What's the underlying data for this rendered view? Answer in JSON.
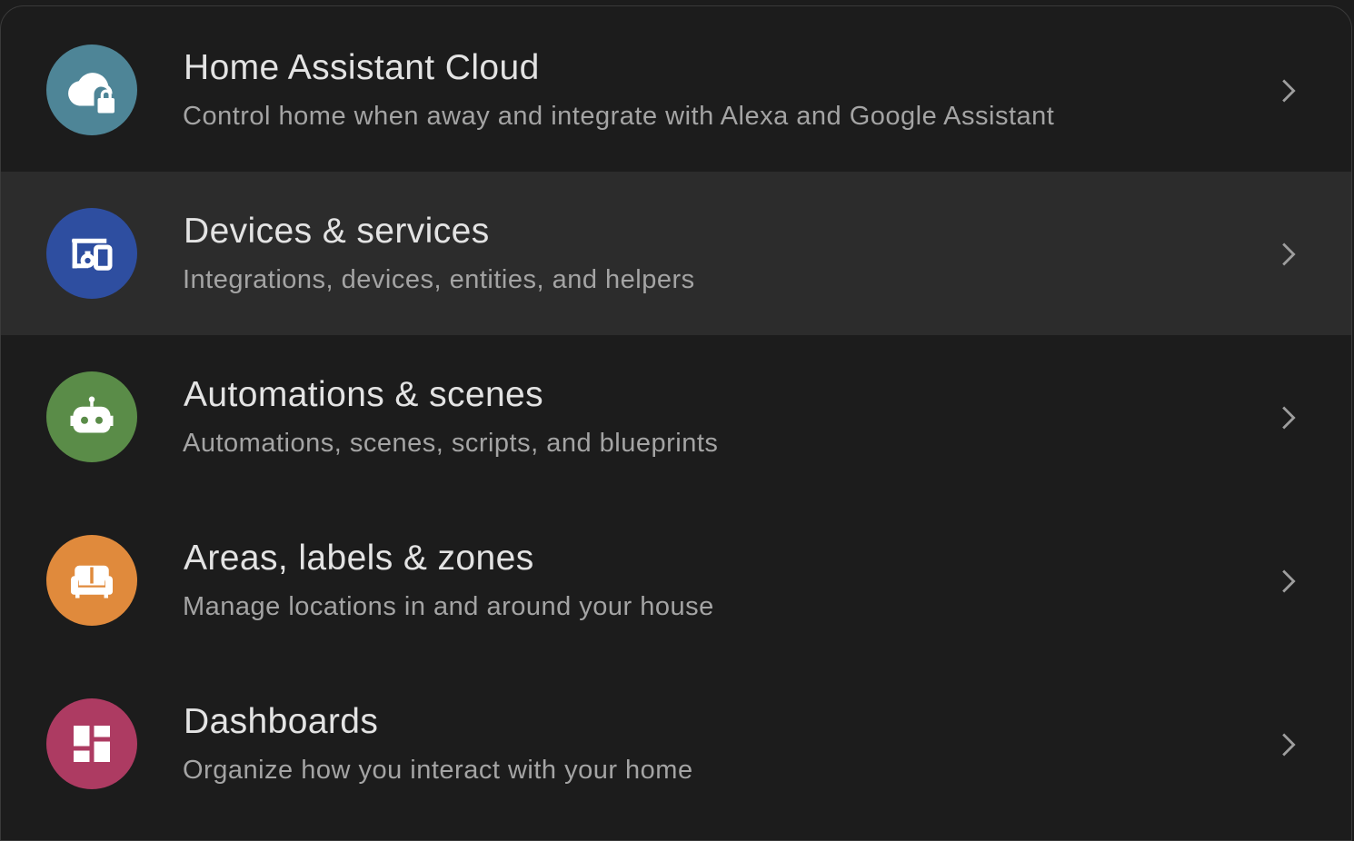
{
  "colors": {
    "background": "#1c1c1c",
    "active_row": "#2c2c2c",
    "title_text": "#e3e3e3",
    "subtitle_text": "#a4a4a4",
    "chevron": "#9e9e9e"
  },
  "menu": {
    "items": [
      {
        "title": "Home Assistant Cloud",
        "subtitle": "Control home when away and integrate with Alexa and Google Assistant",
        "icon": "cloud-lock-icon",
        "icon_color": "#4e8597"
      },
      {
        "title": "Devices & services",
        "subtitle": "Integrations, devices, entities, and helpers",
        "icon": "devices-icon",
        "icon_color": "#2e4ea0",
        "active": true
      },
      {
        "title": "Automations & scenes",
        "subtitle": "Automations, scenes, scripts, and blueprints",
        "icon": "robot-icon",
        "icon_color": "#5a8c48"
      },
      {
        "title": "Areas, labels & zones",
        "subtitle": "Manage locations in and around your house",
        "icon": "sofa-icon",
        "icon_color": "#e08a3c"
      },
      {
        "title": "Dashboards",
        "subtitle": "Organize how you interact with your home",
        "icon": "dashboard-icon",
        "icon_color": "#ad3b62"
      }
    ]
  }
}
